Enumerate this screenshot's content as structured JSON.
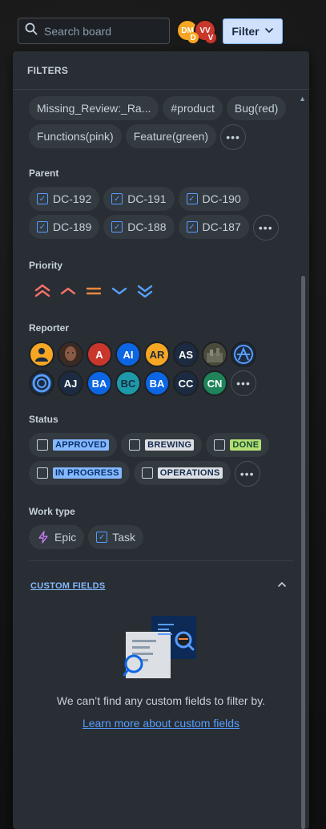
{
  "search": {
    "placeholder": "Search board"
  },
  "avatars_top": [
    {
      "initials": "DM",
      "color": "#f5a623"
    },
    {
      "initials": "VV",
      "color": "#c9372c"
    }
  ],
  "avatars_top_mini": [
    {
      "initials": "D",
      "color": "#f5a623"
    },
    {
      "initials": "V",
      "color": "#c9372c"
    }
  ],
  "filter_button": {
    "label": "Filter"
  },
  "panel": {
    "title": "FILTERS",
    "labels": {
      "chips": [
        "Missing_Review:_Ra...",
        "#product",
        "Bug(red)",
        "Functions(pink)",
        "Feature(green)"
      ]
    },
    "parent": {
      "title": "Parent",
      "items": [
        "DC-192",
        "DC-191",
        "DC-190",
        "DC-189",
        "DC-188",
        "DC-187"
      ]
    },
    "priority": {
      "title": "Priority",
      "icons": [
        "priority-highest-icon",
        "priority-high-icon",
        "priority-medium-icon",
        "priority-low-icon",
        "priority-lowest-icon"
      ]
    },
    "reporter": {
      "title": "Reporter",
      "row1": [
        {
          "initials": "",
          "color": "#f5a623",
          "icon": "person-icon"
        },
        {
          "initials": "",
          "color": "#6b4a3a",
          "icon": "photo-avatar"
        },
        {
          "initials": "A",
          "color": "#c9372c"
        },
        {
          "initials": "AI",
          "color": "#0c66e4"
        },
        {
          "initials": "AR",
          "color": "#f5a623"
        },
        {
          "initials": "AS",
          "color": "#1c2b41"
        },
        {
          "initials": "",
          "color": "#5a5a4a",
          "icon": "photo-avatar"
        },
        {
          "initials": "",
          "color": "#1c2b41",
          "icon": "atlassian-icon"
        }
      ],
      "row2": [
        {
          "initials": "",
          "color": "#1c2b41",
          "icon": "lifebuoy-icon"
        },
        {
          "initials": "AJ",
          "color": "#1c2b41"
        },
        {
          "initials": "BA",
          "color": "#0c66e4"
        },
        {
          "initials": "BC",
          "color": "#1d9aaa"
        },
        {
          "initials": "BA",
          "color": "#0c66e4"
        },
        {
          "initials": "CC",
          "color": "#1c2b41"
        },
        {
          "initials": "CN",
          "color": "#1f845a"
        }
      ]
    },
    "status": {
      "title": "Status",
      "items": [
        {
          "label": "APPROVED",
          "bg": "#85b8ff",
          "fg": "#09326c"
        },
        {
          "label": "BREWING",
          "bg": "#dcdfe4",
          "fg": "#172b4d"
        },
        {
          "label": "DONE",
          "bg": "#b3df72",
          "fg": "#164b35"
        },
        {
          "label": "IN PROGRESS",
          "bg": "#85b8ff",
          "fg": "#09326c"
        },
        {
          "label": "OPERATIONS",
          "bg": "#dcdfe4",
          "fg": "#172b4d"
        }
      ]
    },
    "work_type": {
      "title": "Work type",
      "items": [
        {
          "label": "Epic",
          "icon": "lightning-icon"
        },
        {
          "label": "Task",
          "icon": "checkbox-checked-icon"
        }
      ]
    },
    "custom_fields": {
      "title": "CUSTOM FIELDS",
      "empty_text": "We can’t find any custom fields to filter by.",
      "link": "Learn more about custom fields"
    }
  },
  "colors": {
    "panel_bg": "#282e33",
    "accent": "#579dff",
    "filter_button_bg": "#cfe1fd"
  }
}
